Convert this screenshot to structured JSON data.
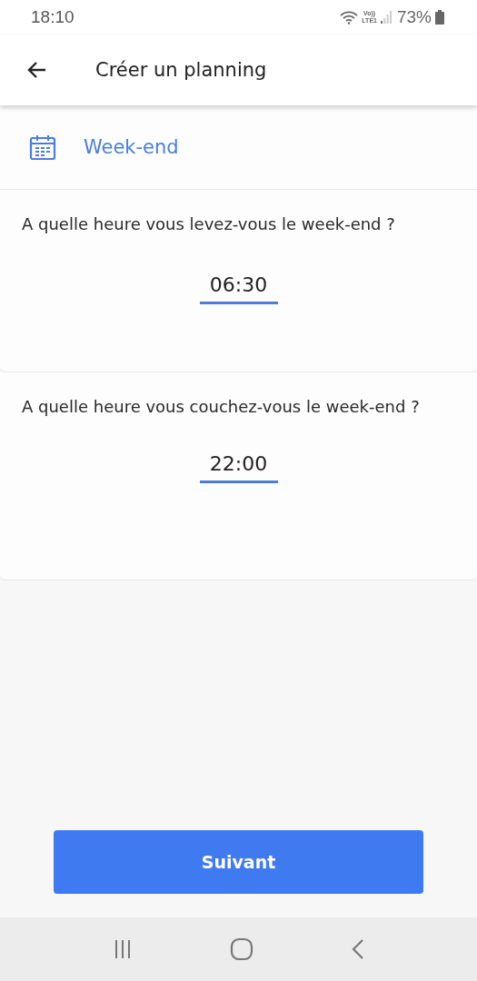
{
  "status_bar": {
    "time": "18:10",
    "network_top": "Vo))",
    "network_bottom": "LTE1",
    "battery": "73%"
  },
  "app_bar": {
    "title": "Créer un planning"
  },
  "section": {
    "title": "Week-end"
  },
  "questions": [
    {
      "label": "A quelle heure vous levez-vous le week-end ?",
      "value": "06:30"
    },
    {
      "label": "A quelle heure vous couchez-vous le week-end ?",
      "value": "22:00"
    }
  ],
  "buttons": [
    {
      "label": "Suivant"
    }
  ]
}
